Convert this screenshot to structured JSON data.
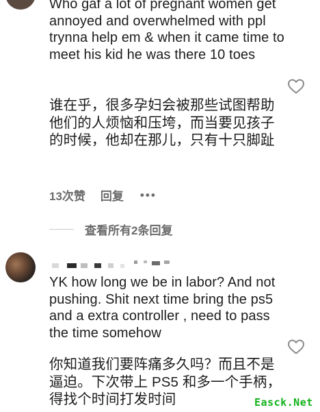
{
  "comment1": {
    "text_en": "Who gaf a lot of pregnant women get annoyed and overwhelmed with ppl trynna help em & when it came time to meet his kid he was there 10 toes",
    "text_zh": "谁在乎，很多孕妇会被那些试图帮助他们的人烦恼和压垮，而当要见孩子的时候，他却在那儿，只有十只脚趾",
    "likes": "13次赞",
    "reply_label": "回复",
    "more_label": "•••",
    "view_replies": "查看所有2条回复"
  },
  "comment2": {
    "text_en": "YK how long we be in labor? And not pushing. Shit next time bring the ps5 and a extra controller , need to pass the time somehow",
    "text_zh": "你知道我们要阵痛多久吗？而且不是逼迫。下次带上 PS5 和多一个手柄，得找个时间打发时间"
  },
  "icons": {
    "like": "heart-outline-icon"
  },
  "watermark": "Easck.Net"
}
